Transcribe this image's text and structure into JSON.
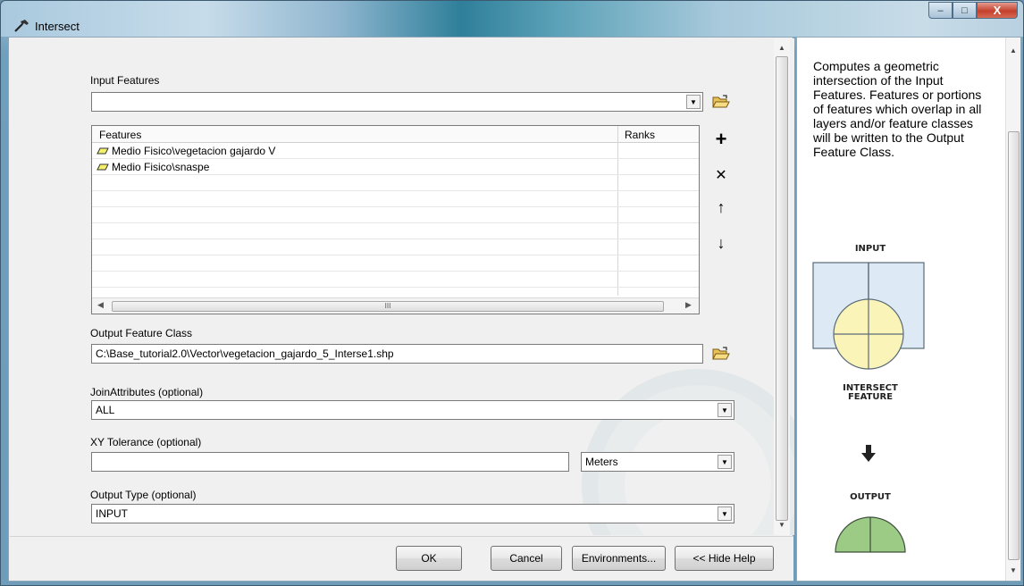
{
  "window": {
    "title": "Intersect",
    "minimize_glyph": "–",
    "maximize_glyph": "□",
    "close_glyph": "X"
  },
  "form": {
    "input_features": {
      "label": "Input Features",
      "value": "",
      "columns": [
        "Features",
        "Ranks"
      ],
      "rows": [
        {
          "feature": "Medio Fisico\\vegetacion gajardo V",
          "rank": ""
        },
        {
          "feature": "Medio Fisico\\snaspe",
          "rank": ""
        }
      ]
    },
    "output_feature_class": {
      "label": "Output Feature Class",
      "value": "C:\\Base_tutorial2.0\\Vector\\vegetacion_gajardo_5_Interse1.shp"
    },
    "join_attributes": {
      "label": "JoinAttributes (optional)",
      "value": "ALL"
    },
    "xy_tolerance": {
      "label": "XY Tolerance (optional)",
      "value": "",
      "unit": "Meters"
    },
    "output_type": {
      "label": "Output Type (optional)",
      "value": "INPUT"
    }
  },
  "list_tools": {
    "add": "+",
    "remove": "✕",
    "up": "↑",
    "down": "↓"
  },
  "scroll_thumb_grip": "III",
  "buttons": {
    "ok": "OK",
    "cancel": "Cancel",
    "environments": "Environments...",
    "hide_help": "<< Hide Help"
  },
  "help": {
    "text": "Computes a geometric intersection of the Input Features. Features or portions of features which overlap in all layers and/or feature classes will be written to the Output Feature Class.",
    "diagram": {
      "input_label": "INPUT",
      "intersect_label_1": "INTERSECT",
      "intersect_label_2": "FEATURE",
      "output_label": "OUTPUT"
    }
  },
  "colors": {
    "poly_fill": "#f5f06a",
    "diagram_square": "#ddeaf6",
    "diagram_circle": "#fbf4b8",
    "diagram_output": "#9ccb86"
  }
}
